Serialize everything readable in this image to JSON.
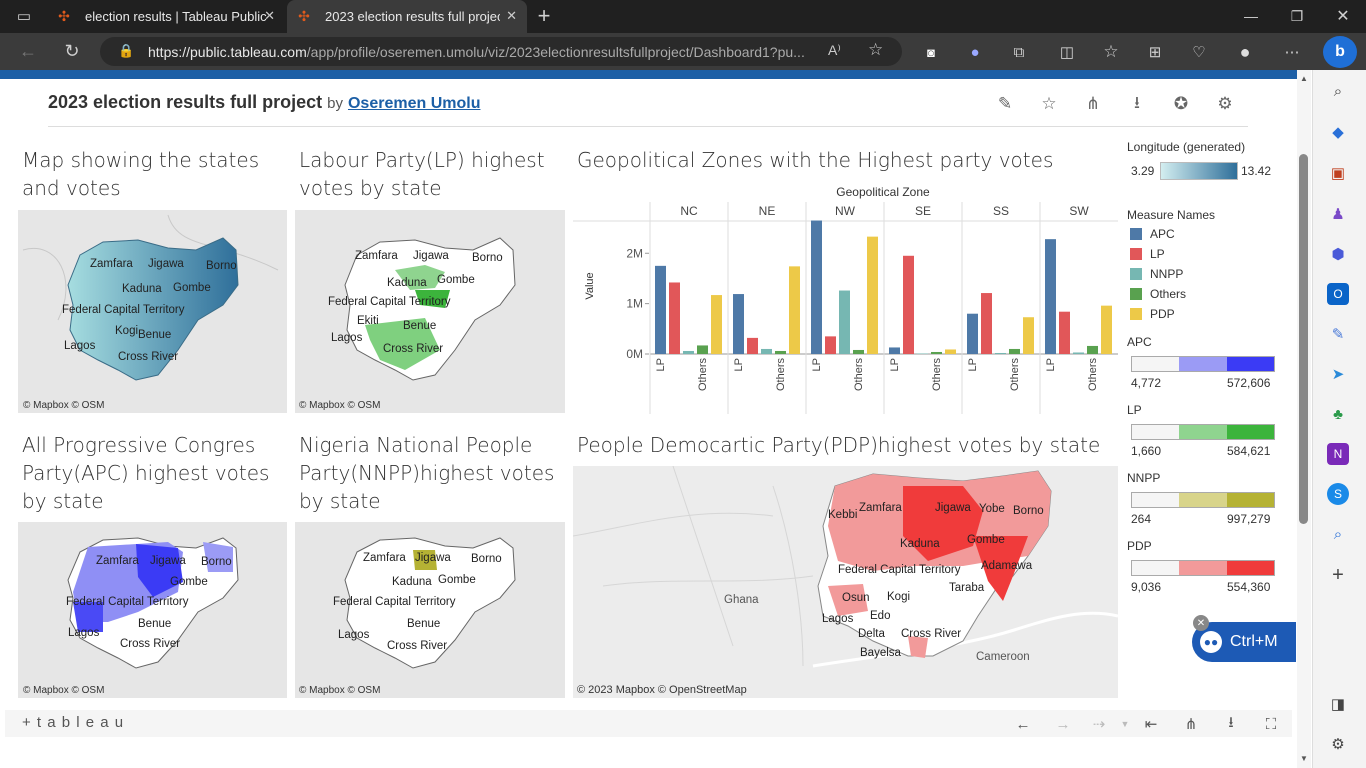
{
  "browser": {
    "tabs": [
      {
        "title": "election results | Tableau Public"
      },
      {
        "title": "2023 election results full project |"
      }
    ],
    "url_host": "https://public.tableau.com",
    "url_path": "/app/profile/oseremen.umolu/viz/2023electionresultsfullproject/Dashboard1?pu..."
  },
  "header": {
    "title": "2023 election results full project",
    "by": "by",
    "author": "Oseremen Umolu"
  },
  "panels": {
    "map_states": {
      "title": "Map showing the states and votes",
      "credit": "© Mapbox  © OSM"
    },
    "lp": {
      "title": "Labour Party(LP) highest votes by state",
      "credit": "© Mapbox  © OSM"
    },
    "apc": {
      "title": "All Progressive Congres Party(APC) highest votes by state",
      "credit": "© Mapbox  © OSM"
    },
    "nnpp": {
      "title": "Nigeria National People Party(NNPP)highest votes by state",
      "credit": "© Mapbox  © OSM"
    },
    "pdp": {
      "title": "People Democartic Party(PDP)highest votes by state",
      "credit": "© 2023 Mapbox  © OpenStreetMap"
    },
    "zones": {
      "title": "Geopolitical Zones with the Highest party votes"
    }
  },
  "map_labels": {
    "states1": [
      "Zamfara",
      "Jigawa",
      "Borno",
      "Kaduna",
      "Gombe",
      "Federal Capital Territory",
      "Kogi",
      "Benue",
      "Lagos",
      "Cross River"
    ],
    "lp": [
      "Zamfara",
      "Jigawa",
      "Borno",
      "Kaduna",
      "Gombe",
      "Federal Capital Territory",
      "Ekiti",
      "Benue",
      "Lagos",
      "Cross River"
    ],
    "apc": [
      "Zamfara",
      "Jigawa",
      "Borno",
      "Gombe",
      "Federal Capital Territory",
      "Benue",
      "Lagos",
      "Cross River"
    ],
    "nnpp": [
      "Zamfara",
      "Jigawa",
      "Borno",
      "Kaduna",
      "Gombe",
      "Federal Capital Territory",
      "Benue",
      "Lagos",
      "Cross River"
    ],
    "pdp": [
      "Kebbi",
      "Zamfara",
      "Jigawa",
      "Yobe",
      "Borno",
      "Kaduna",
      "Gombe",
      "Adamawa",
      "Federal Capital Territory",
      "Taraba",
      "Ghana",
      "Osun",
      "Kogi",
      "Lagos",
      "Edo",
      "Delta",
      "Cross River",
      "Bayelsa",
      "Cameroon"
    ]
  },
  "legends": {
    "longitude": {
      "title": "Longitude (generated)",
      "min": "3.29",
      "max": "13.42"
    },
    "measure_names": {
      "title": "Measure Names",
      "items": [
        {
          "label": "APC",
          "color": "#4e79a7"
        },
        {
          "label": "LP",
          "color": "#e15759"
        },
        {
          "label": "NNPP",
          "color": "#76b7b2"
        },
        {
          "label": "Others",
          "color": "#59a14f"
        },
        {
          "label": "PDP",
          "color": "#edc948"
        }
      ]
    },
    "apc": {
      "title": "APC",
      "min": "4,772",
      "max": "572,606",
      "color": "#3b3bf5"
    },
    "lp": {
      "title": "LP",
      "min": "1,660",
      "max": "584,621",
      "color": "#3cb43c"
    },
    "nnpp": {
      "title": "NNPP",
      "min": "264",
      "max": "997,279",
      "color": "#b5b234"
    },
    "pdp": {
      "title": "PDP",
      "min": "9,036",
      "max": "554,360",
      "color": "#f03b3b"
    }
  },
  "chart_data": {
    "type": "bar",
    "title": "Geopolitical Zones with the Highest party votes",
    "column_header": "Geopolitical Zone",
    "ylabel": "Value",
    "ylim": [
      0,
      2700000
    ],
    "y_ticks": [
      "0M",
      "1M",
      "2M"
    ],
    "zones": [
      "NC",
      "NE",
      "NW",
      "SE",
      "SS",
      "SW"
    ],
    "x_tick_labels": [
      "LP",
      "Others"
    ],
    "series": [
      {
        "name": "APC",
        "values": [
          1750000,
          1190000,
          2650000,
          130000,
          800000,
          2280000
        ]
      },
      {
        "name": "LP",
        "values": [
          1420000,
          320000,
          350000,
          1950000,
          1210000,
          840000
        ]
      },
      {
        "name": "NNPP",
        "values": [
          60000,
          100000,
          1260000,
          10000,
          20000,
          30000
        ]
      },
      {
        "name": "Others",
        "values": [
          170000,
          60000,
          80000,
          40000,
          100000,
          160000
        ]
      },
      {
        "name": "PDP",
        "values": [
          1170000,
          1740000,
          2330000,
          90000,
          730000,
          960000
        ]
      }
    ]
  },
  "footer": {
    "brand": "+ t a b l e a u"
  },
  "edge_popup": {
    "label": "Ctrl+M"
  }
}
